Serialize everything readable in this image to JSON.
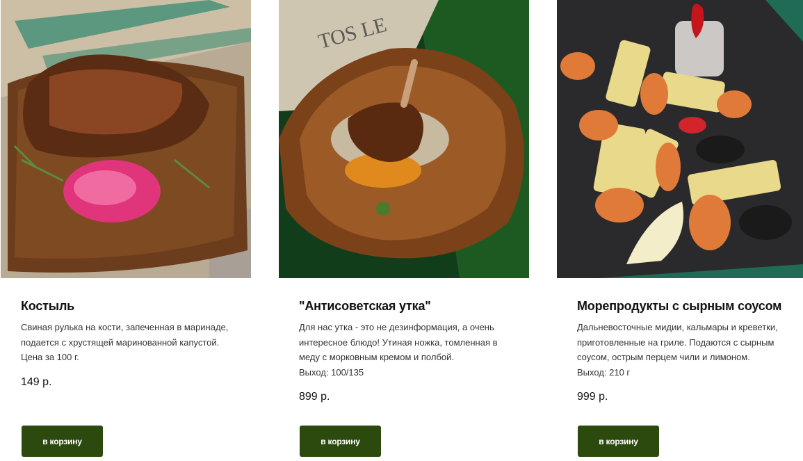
{
  "products": [
    {
      "title": "Костыль",
      "description": "Свиная рулька на кости, запеченная в маринаде, подается с хрустящей маринованной капустой.",
      "note": "Цена за 100 г.",
      "price": "149 р.",
      "button_label": "в корзину",
      "image": "pork-knuckle-photo"
    },
    {
      "title": "\"Антисоветская утка\"",
      "description": "Для нас утка - это не дезинформация, а очень интересное блюдо! Утиная ножка, томленная в меду с морковным кремом и полбой.",
      "note": "Выход: 100/135",
      "price": "899 р.",
      "button_label": "в корзину",
      "image": "duck-leg-photo"
    },
    {
      "title": "Морепродукты с сырным соусом",
      "description": "Дальневосточные мидии, кальмары и креветки, приготовленные на гриле. Подаются с сырным соусом, острым перцем чили и лимоном.",
      "note": "Выход: 210 г",
      "price": "999 р.",
      "button_label": "в корзину",
      "image": "seafood-photo"
    }
  ],
  "colors": {
    "button": "#2d4a0e",
    "button_text": "#ffffff",
    "title": "#111111",
    "text": "#333333"
  }
}
